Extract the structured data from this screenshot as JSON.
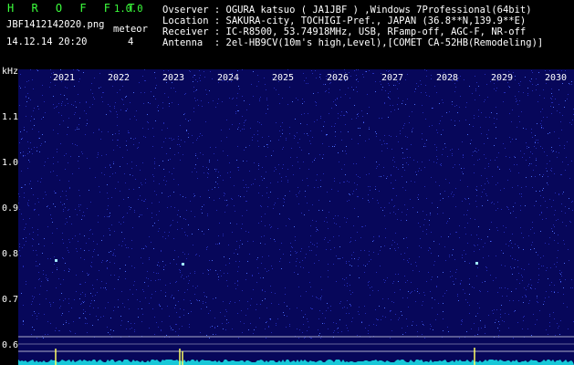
{
  "app": {
    "name": "H R O F F T",
    "version": "1.0.0",
    "filename": "JBF1412142020.png",
    "timestamp": "14.12.14 20:20",
    "meteor_label": "meteor",
    "meteor_count": "4"
  },
  "info": {
    "observer": "Ovserver : OGURA katsuo ( JA1JBF ) ,Windows 7Professional(64bit)",
    "location": "Location : SAKURA-city, TOCHIGI-Pref., JAPAN (36.8**N,139.9**E)",
    "receiver": "Receiver : IC-R8500, 53.74918MHz, USB, RFamp-off, AGC-F, NR-off",
    "antenna": "Antenna  : 2el-HB9CV(10m's high,Level),[COMET CA-52HB(Remodeling)]"
  },
  "axis": {
    "y_unit": "kHz",
    "y_ticks": [
      "1.1",
      "1.0",
      "0.9",
      "0.8",
      "0.7",
      "0.6"
    ],
    "x_ticks": [
      "2021",
      "2022",
      "2023",
      "2024",
      "2025",
      "2026",
      "2027",
      "2028",
      "2029",
      "2030"
    ]
  },
  "colors": {
    "background": "#07075a",
    "noise": "#2a34c8",
    "signal": "#9fe8ff",
    "trace": "#17c8d8",
    "marker": "#ffff60"
  }
}
